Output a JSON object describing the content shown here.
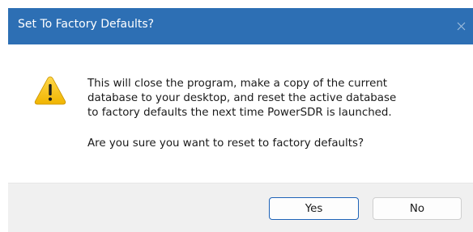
{
  "window": {
    "title": "Set To Factory Defaults?",
    "close_glyph": "✕"
  },
  "message": {
    "line1": "This will close the program, make a copy of the current",
    "line2": "database to your desktop, and reset the active database",
    "line3": "to factory defaults the next time PowerSDR is launched.",
    "question": "Are you sure you want to reset to factory defaults?"
  },
  "icon": {
    "name": "warning-icon",
    "color": "#f5c518"
  },
  "buttons": {
    "yes_label": "Yes",
    "no_label": "No"
  },
  "colors": {
    "titlebar": "#2d6fb4",
    "footer": "#f0f0f0",
    "default_button_border": "#1d62b7"
  }
}
